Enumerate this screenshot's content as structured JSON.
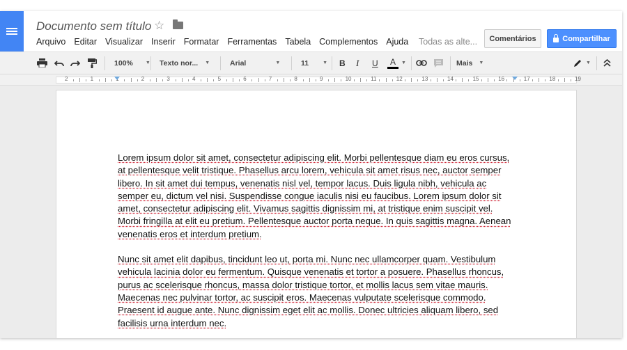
{
  "header": {
    "title": "Documento sem título",
    "menus": [
      "Arquivo",
      "Editar",
      "Visualizar",
      "Inserir",
      "Formatar",
      "Ferramentas",
      "Tabela",
      "Complementos",
      "Ajuda"
    ],
    "menu_note": "Todas as alte...",
    "comments_label": "Comentários",
    "share_label": "Compartilhar"
  },
  "toolbar": {
    "zoom": "100%",
    "style": "Texto nor...",
    "font": "Arial",
    "size": "11",
    "bold": "B",
    "italic": "I",
    "underline": "U",
    "text_color": "A",
    "more": "Mais"
  },
  "ruler": {
    "labels": [
      "2",
      "1",
      "1",
      "2",
      "3",
      "4",
      "5",
      "6",
      "7",
      "8",
      "9",
      "10",
      "11",
      "12",
      "13",
      "14",
      "15",
      "16",
      "17",
      "18",
      "19"
    ]
  },
  "document": {
    "paragraphs": [
      "Lorem ipsum dolor sit amet, consectetur adipiscing elit. Morbi pellentesque diam eu eros cursus, at pellentesque velit tristique. Phasellus arcu lorem, vehicula sit amet risus nec, auctor semper libero. In sit amet dui tempus, venenatis nisl vel, tempor lacus. Duis ligula nibh, vehicula ac semper eu, dictum vel nisi. Suspendisse congue iaculis nisi eu faucibus. Lorem ipsum dolor sit amet, consectetur adipiscing elit. Vivamus sagittis dignissim mi, at tristique enim suscipit vel. Morbi fringilla at elit eu pretium. Pellentesque auctor porta neque. In quis sagittis magna. Aenean venenatis eros et interdum pretium.",
      "Nunc sit amet elit dapibus, tincidunt leo ut, porta mi. Nunc nec ullamcorper quam. Vestibulum vehicula lacinia dolor eu fermentum. Quisque venenatis et tortor a posuere. Phasellus rhoncus, purus ac scelerisque rhoncus, massa dolor tristique tortor, et mollis lacus sem vitae mauris. Maecenas nec pulvinar tortor, ac suscipit eros. Maecenas vulputate scelerisque commodo. Praesent id augue ante. Nunc dignissim eget elit ac mollis. Donec ultricies aliquam libero, sed facilisis urna interdum nec."
    ]
  },
  "colors": {
    "brand": "#4285f4",
    "share": "#4d90fe",
    "spellcheck": "#cc2233"
  }
}
